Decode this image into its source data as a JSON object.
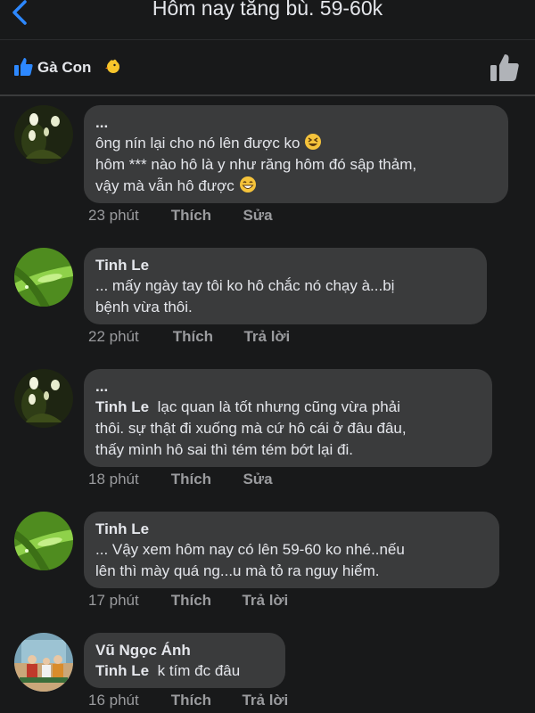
{
  "header": {
    "title": "Hôm nay tăng bù. 59-60k"
  },
  "likes": {
    "names": "Gà Con"
  },
  "comments": [
    {
      "author": "...",
      "lines": [
        "ông nín lại cho nó lên được ko",
        "hôm *** nào hô là y như răng hôm đó sập thảm,",
        "vậy mà vẫn hô được"
      ],
      "time": "23 phút",
      "like": "Thích",
      "action": "Sửa"
    },
    {
      "author": "Tinh Le",
      "lines": [
        "...  mấy ngày tay tôi ko hô chắc nó chạy à...bị",
        "bệnh vừa thôi."
      ],
      "time": "22 phút",
      "like": "Thích",
      "action": "Trả lời"
    },
    {
      "author": "...",
      "tag": "Tinh Le",
      "lines": [
        "lạc quan là tốt nhưng cũng vừa phải",
        "thôi. sự thật đi xuống mà cứ hô cái ở đâu đâu,",
        "thấy mình hô sai thì tém tém bớt lại đi."
      ],
      "time": "18 phút",
      "like": "Thích",
      "action": "Sửa"
    },
    {
      "author": "Tinh Le",
      "lines": [
        "...  Vậy xem hôm nay có lên 59-60 ko nhé..nếu",
        "lên thì mày quá ng...u mà tỏ ra nguy hiểm."
      ],
      "time": "17 phút",
      "like": "Thích",
      "action": "Trả lời"
    },
    {
      "author": "Vũ Ngọc Ánh",
      "tag": "Tinh Le",
      "lines": [
        "k tím đc đâu"
      ],
      "time": "16 phút",
      "like": "Thích",
      "action": "Trả lời"
    }
  ]
}
